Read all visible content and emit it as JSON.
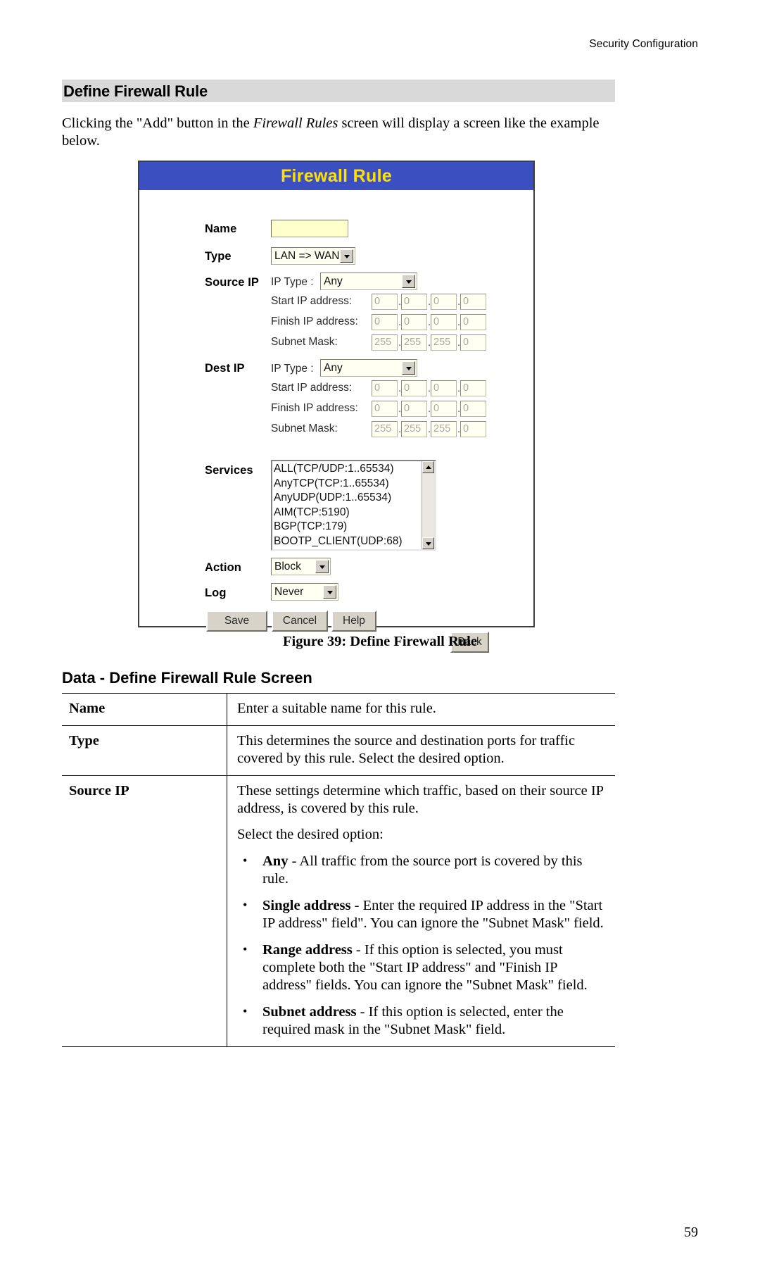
{
  "page": {
    "running_head": "Security Configuration",
    "number": "59",
    "section_title": "Define Firewall Rule",
    "intro_before": "Clicking the \"Add\" button in the ",
    "intro_italic": "Firewall Rules",
    "intro_after": " screen will display a screen like the example below.",
    "figure_caption": "Figure 39: Define Firewall Rule",
    "data_heading": "Data - Define Firewall Rule Screen"
  },
  "firewall_rule_screen": {
    "title": "Firewall Rule",
    "title_color": "#ffe100",
    "titlebar_color": "#3c4fc1",
    "fields": {
      "name_label": "Name",
      "name_value": "",
      "type_label": "Type",
      "type_value": "LAN => WAN",
      "source_ip_label": "Source IP",
      "dest_ip_label": "Dest IP",
      "ip_type_label": "IP Type :",
      "start_ip_label": "Start IP address:",
      "finish_ip_label": "Finish IP address:",
      "subnet_mask_label": "Subnet Mask:",
      "services_label": "Services",
      "action_label": "Action",
      "action_value": "Block",
      "log_label": "Log",
      "log_value": "Never"
    },
    "source_ip": {
      "ip_type_value": "Any",
      "start_ip": [
        "0",
        "0",
        "0",
        "0"
      ],
      "finish_ip": [
        "0",
        "0",
        "0",
        "0"
      ],
      "subnet_mask": [
        "255",
        "255",
        "255",
        "0"
      ]
    },
    "dest_ip": {
      "ip_type_value": "Any",
      "start_ip": [
        "0",
        "0",
        "0",
        "0"
      ],
      "finish_ip": [
        "0",
        "0",
        "0",
        "0"
      ],
      "subnet_mask": [
        "255",
        "255",
        "255",
        "0"
      ]
    },
    "services": [
      "ALL(TCP/UDP:1..65534)",
      "AnyTCP(TCP:1..65534)",
      "AnyUDP(UDP:1..65534)",
      "AIM(TCP:5190)",
      "BGP(TCP:179)",
      "BOOTP_CLIENT(UDP:68)"
    ],
    "buttons": {
      "save": "Save",
      "cancel": "Cancel",
      "help": "Help",
      "back": "Back"
    }
  },
  "data_table": {
    "rows": [
      {
        "key": "Name",
        "paragraphs": [
          "Enter a suitable name for this rule."
        ],
        "bullets": []
      },
      {
        "key": "Type",
        "paragraphs": [
          "This determines the source and destination ports for traffic covered by this rule. Select the desired option."
        ],
        "bullets": []
      },
      {
        "key": "Source IP",
        "paragraphs": [
          "These settings determine which traffic, based on their source IP address, is covered by this rule.",
          "Select the desired option:"
        ],
        "bullets": [
          {
            "term": "Any",
            "dash": " - ",
            "text": "All traffic from the source port is covered by this rule."
          },
          {
            "term": "Single address",
            "dash": " - ",
            "text": "Enter the required IP address in the \"Start IP address\" field\". You can ignore the \"Subnet Mask\" field."
          },
          {
            "term": "Range address",
            "dash": " - ",
            "text": "If this option is selected, you must complete both the \"Start IP address\" and \"Finish IP address\" fields. You can ignore the \"Subnet Mask\" field."
          },
          {
            "term": "Subnet address",
            "dash": " - ",
            "text": "If this option is selected, enter the required mask in the \"Subnet Mask\" field."
          }
        ]
      }
    ]
  }
}
